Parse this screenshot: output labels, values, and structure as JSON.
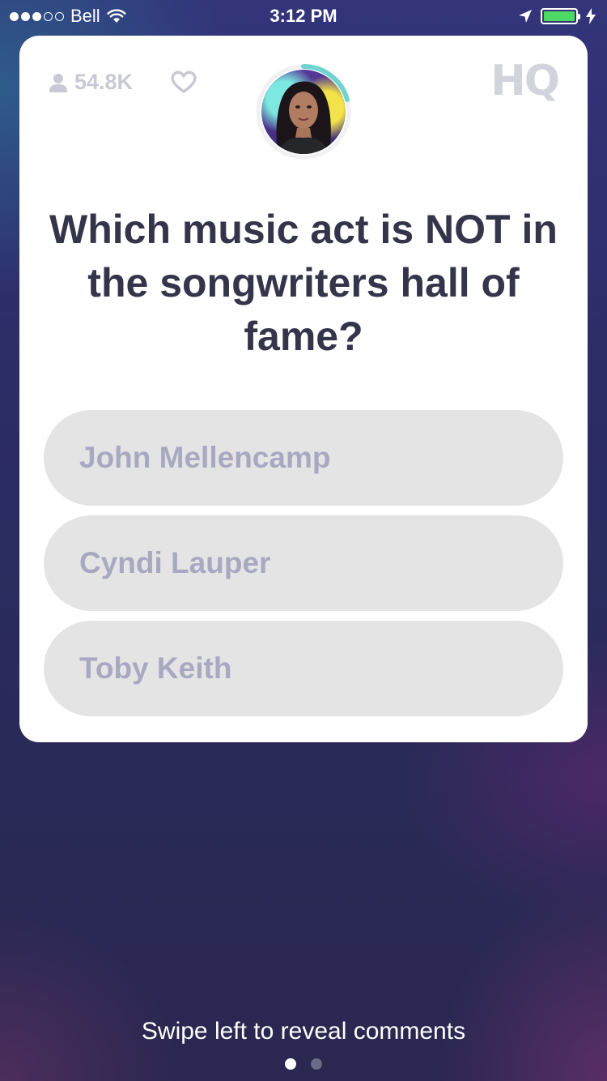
{
  "status_bar": {
    "carrier": "Bell",
    "time": "3:12 PM",
    "signal_bars_filled": 3,
    "signal_bars_total": 5,
    "battery_color": "#4cd964"
  },
  "card": {
    "viewer_count": "54.8K",
    "logo": "HQ",
    "question": "Which music act is NOT in the songwriters hall of fame?",
    "answers": [
      {
        "label": "John Mellencamp"
      },
      {
        "label": "Cyndi Lauper"
      },
      {
        "label": "Toby Keith"
      }
    ]
  },
  "footer": {
    "swipe_hint": "Swipe left to reveal comments",
    "page_count": 2,
    "active_page": 1
  },
  "colors": {
    "question_text": "#34354a",
    "answer_bg": "#e4e4e4",
    "answer_text": "#a8a8c2",
    "timer_ring": "#6fd3d0"
  },
  "icons": [
    "wifi-icon",
    "location-arrow-icon",
    "battery-icon",
    "charging-bolt-icon",
    "person-icon",
    "heart-icon"
  ]
}
